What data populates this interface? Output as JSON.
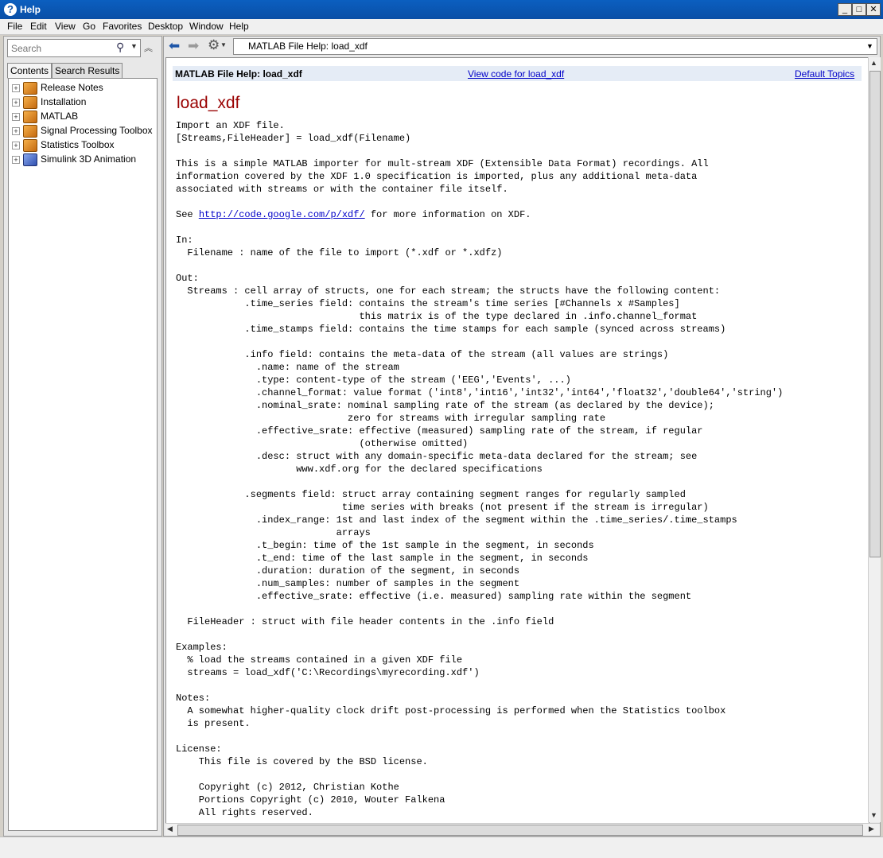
{
  "window": {
    "title": "Help"
  },
  "menu": [
    "File",
    "Edit",
    "View",
    "Go",
    "Favorites",
    "Desktop",
    "Window",
    "Help"
  ],
  "search": {
    "placeholder": "Search"
  },
  "tabs": [
    "Contents",
    "Search Results"
  ],
  "tree": [
    {
      "label": "Release Notes",
      "icon": "orange-book-icon"
    },
    {
      "label": "Installation",
      "icon": "orange-book-icon"
    },
    {
      "label": "MATLAB",
      "icon": "orange-book-icon"
    },
    {
      "label": "Signal Processing Toolbox",
      "icon": "orange-book-icon"
    },
    {
      "label": "Statistics Toolbox",
      "icon": "orange-book-icon"
    },
    {
      "label": "Simulink 3D Animation",
      "icon": "blue-book-icon"
    }
  ],
  "address": "MATLAB File Help: load_xdf",
  "doc": {
    "header_title": "MATLAB File Help: load_xdf",
    "view_code_link": "View code for load_xdf",
    "default_topics_link": "Default Topics",
    "title": "load_xdf",
    "text_before_link": "Import an XDF file.\n[Streams,FileHeader] = load_xdf(Filename)\n\nThis is a simple MATLAB importer for mult-stream XDF (Extensible Data Format) recordings. All\ninformation covered by the XDF 1.0 specification is imported, plus any additional meta-data\nassociated with streams or with the container file itself.\n\nSee ",
    "link": "http://code.google.com/p/xdf/",
    "text_after_link": " for more information on XDF.\n\nIn:\n  Filename : name of the file to import (*.xdf or *.xdfz)\n\nOut:\n  Streams : cell array of structs, one for each stream; the structs have the following content:\n            .time_series field: contains the stream's time series [#Channels x #Samples]\n                                this matrix is of the type declared in .info.channel_format\n            .time_stamps field: contains the time stamps for each sample (synced across streams)\n\n            .info field: contains the meta-data of the stream (all values are strings)\n              .name: name of the stream\n              .type: content-type of the stream ('EEG','Events', ...)\n              .channel_format: value format ('int8','int16','int32','int64','float32','double64','string')\n              .nominal_srate: nominal sampling rate of the stream (as declared by the device);\n                              zero for streams with irregular sampling rate\n              .effective_srate: effective (measured) sampling rate of the stream, if regular\n                                (otherwise omitted)\n              .desc: struct with any domain-specific meta-data declared for the stream; see\n                     www.xdf.org for the declared specifications\n\n            .segments field: struct array containing segment ranges for regularly sampled\n                             time series with breaks (not present if the stream is irregular)\n              .index_range: 1st and last index of the segment within the .time_series/.time_stamps\n                            arrays\n              .t_begin: time of the 1st sample in the segment, in seconds\n              .t_end: time of the last sample in the segment, in seconds\n              .duration: duration of the segment, in seconds\n              .num_samples: number of samples in the segment\n              .effective_srate: effective (i.e. measured) sampling rate within the segment\n\n  FileHeader : struct with file header contents in the .info field\n\nExamples:\n  % load the streams contained in a given XDF file\n  streams = load_xdf('C:\\Recordings\\myrecording.xdf')\n\nNotes:\n  A somewhat higher-quality clock drift post-processing is performed when the Statistics toolbox\n  is present.\n\nLicense:\n    This file is covered by the BSD license.\n\n    Copyright (c) 2012, Christian Kothe\n    Portions Copyright (c) 2010, Wouter Falkena\n    All rights reserved."
  }
}
